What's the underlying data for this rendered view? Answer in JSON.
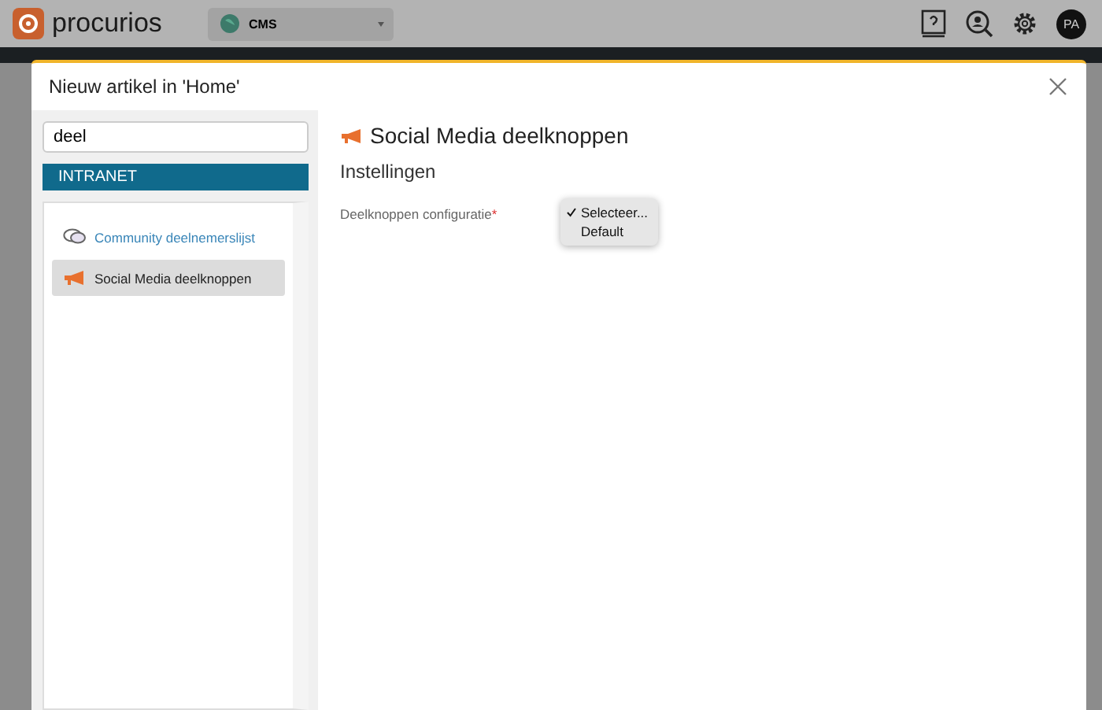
{
  "topbar": {
    "brand": "procurios",
    "site_select": {
      "value": "CMS"
    },
    "avatar": "PA"
  },
  "modal": {
    "title": "Nieuw artikel in 'Home'",
    "search": {
      "value": "deel"
    },
    "category": "INTRANET",
    "items": [
      {
        "label": "Community deelnemerslijst",
        "kind": "chat",
        "selected": false
      },
      {
        "label": "Social Media deelknoppen",
        "kind": "megaphone",
        "selected": true
      }
    ],
    "heading": "Social Media deelknoppen",
    "section": "Instellingen",
    "field": {
      "label": "Deelknoppen configuratie",
      "required_mark": "*",
      "options": [
        {
          "label": "Selecteer...",
          "selected": true
        },
        {
          "label": "Default",
          "selected": false
        }
      ]
    }
  }
}
